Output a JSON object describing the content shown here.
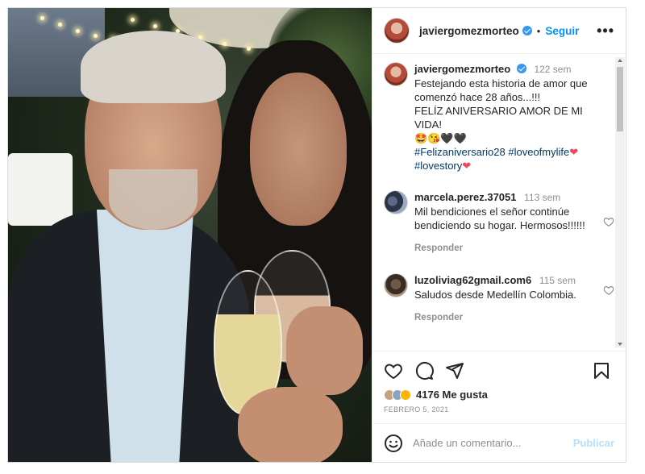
{
  "post": {
    "author": "javiergomezmorteo",
    "follow_label": "Seguir",
    "separator": "•",
    "more_label": "•••"
  },
  "caption": {
    "username": "javiergomezmorteo",
    "time": "122 sem",
    "line1": "Festejando esta historia de amor que comenzó hace 28 años...!!!",
    "line2": "FELÍZ ANIVERSARIO AMOR DE MI VIDA!",
    "emojis": "🤩😘🖤🖤",
    "hashtag1": "#Felizaniversario28",
    "hashtag2": "#loveofmylife",
    "hashtag3": "#lovestory",
    "heart": "❤"
  },
  "comments": [
    {
      "username": "marcela.perez.37051",
      "time": "113 sem",
      "text": "Mil bendiciones el señor continúe bendiciendo su hogar. Hermosos!!!!!!",
      "reply_label": "Responder"
    },
    {
      "username": "luzoliviag62gmail.com6",
      "time": "115 sem",
      "text": "Saludos desde Medellín Colombia.",
      "reply_label": "Responder"
    }
  ],
  "likes": {
    "count_label": "4176 Me gusta",
    "date": "FEBRERO 5, 2021"
  },
  "add_comment": {
    "placeholder": "Añade un comentario...",
    "publish_label": "Publicar"
  },
  "colors": {
    "accent": "#0095f6",
    "verified": "#3897f0",
    "hashtag": "#00376b",
    "heart": "#ed4956"
  },
  "icons": [
    "verified-icon",
    "more-icon",
    "heart-icon",
    "comment-icon",
    "share-icon",
    "save-icon",
    "emoji-icon"
  ]
}
